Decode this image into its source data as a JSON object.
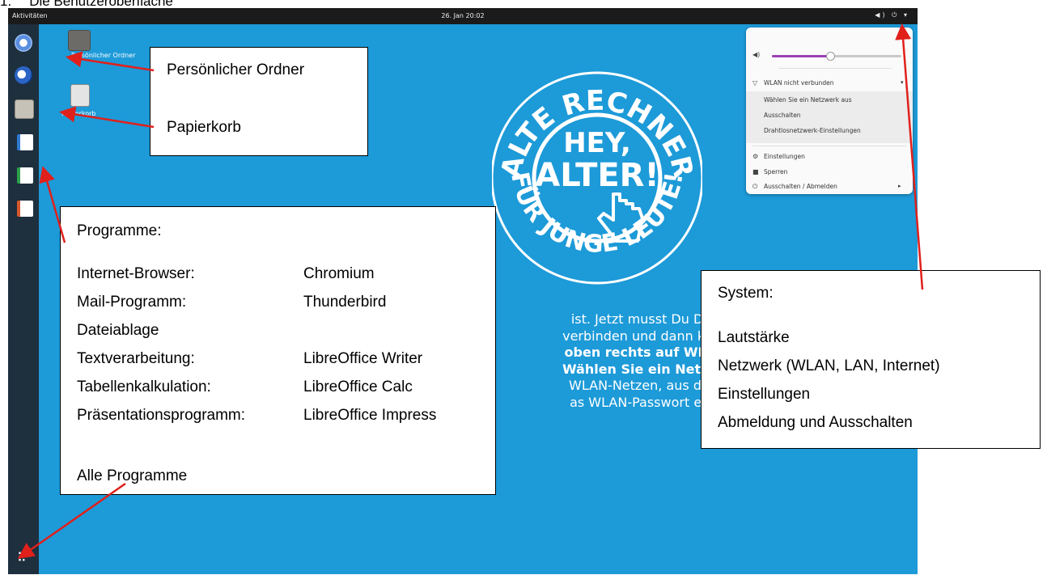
{
  "document": {
    "heading_number": "1.",
    "heading": "Die Benutzeroberfläche"
  },
  "topbar": {
    "activities": "Aktivitäten",
    "clock": "26. Jan 20:02",
    "system_glyphs": "◀) ⏻ ▾"
  },
  "desktop": {
    "home_label": "Persönlicher Ordner",
    "trash_label": "Papierkorb",
    "poster_lines": [
      "ist. Jetzt musst Du Deir",
      "verbinden und dann kann",
      "oben rechts auf WLAN",
      "Wählen Sie ein Netzwe",
      "WLAN-Netzen, aus der l",
      "as WLAN-Passwort eing"
    ]
  },
  "system_menu": {
    "volume_percent": 45,
    "wifi_status": "WLAN nicht verbunden",
    "wifi_items": [
      "Wählen Sie ein Netzwerk aus",
      "Ausschalten",
      "Drahtlosnetzwerk-Einstellungen"
    ],
    "settings": "Einstellungen",
    "lock": "Sperren",
    "power": "Ausschalten / Abmelden"
  },
  "callouts": {
    "home": "Persönlicher Ordner",
    "trash": "Papierkorb",
    "programs_title": "Programme:",
    "programs": [
      {
        "label": "Internet-Browser:",
        "value": "Chromium"
      },
      {
        "label": "Mail-Programm:",
        "value": "Thunderbird"
      },
      {
        "label": "Dateiablage",
        "value": ""
      },
      {
        "label": "Textverarbeitung:",
        "value": "LibreOffice Writer"
      },
      {
        "label": "Tabellenkalkulation:",
        "value": "LibreOffice Calc"
      },
      {
        "label": "Präsentationsprogramm:",
        "value": "LibreOffice Impress"
      }
    ],
    "all_programs": "Alle Programme",
    "system_title": "System:",
    "system_items": [
      "Lautstärke",
      "Netzwerk (WLAN, LAN, Internet)",
      "Einstellungen",
      "Abmeldung und Ausschalten"
    ]
  },
  "colors": {
    "desktop": "#1d9ad8",
    "dock": "#1e2f3e",
    "accent": "#9b3fb5",
    "arrow": "#e0201b"
  }
}
